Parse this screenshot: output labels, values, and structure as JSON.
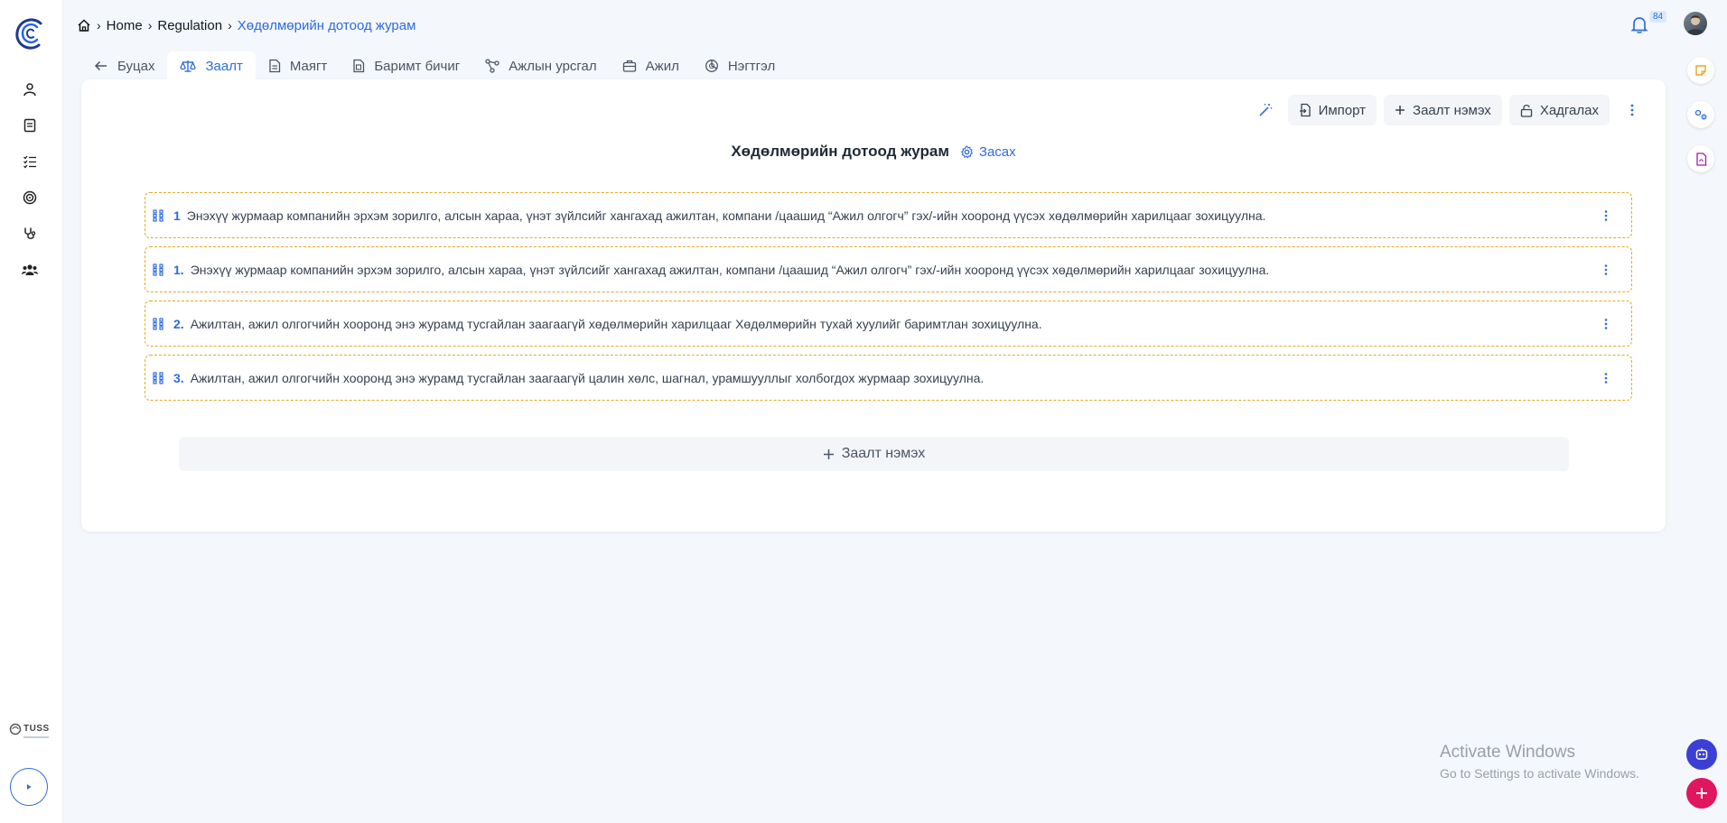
{
  "breadcrumb": {
    "items": [
      "Home",
      "Regulation"
    ],
    "current": "Хөдөлмөрийн дотоод журам"
  },
  "notifications": {
    "count": "84"
  },
  "tabs": [
    {
      "label": "Буцах",
      "icon": "arrow-left-icon"
    },
    {
      "label": "Заалт",
      "icon": "scale-icon"
    },
    {
      "label": "Маягт",
      "icon": "document-icon"
    },
    {
      "label": "Баримт бичиг",
      "icon": "file-text-icon"
    },
    {
      "label": "Ажлын урсгал",
      "icon": "workflow-icon"
    },
    {
      "label": "Ажил",
      "icon": "briefcase-icon"
    },
    {
      "label": "Нэгтгэл",
      "icon": "chart-pie-icon"
    }
  ],
  "toolbar": {
    "import_label": "Импорт",
    "add_clause_label": "Заалт нэмэх",
    "save_label": "Хадгалах"
  },
  "document": {
    "title": "Хөдөлмөрийн дотоод журам",
    "edit_label": "Засах"
  },
  "clauses": [
    {
      "number": "1",
      "text": "Энэхүү журмаар компанийн эрхэм зорилго, алсын хараа, үнэт зүйлсийг хангахад ажилтан, компани /цаашид “Ажил олгогч” гэх/-ийн хооронд үүсэх хөдөлмөрийн харилцааг зохицуулна."
    },
    {
      "number": "1.",
      "text": "Энэхүү журмаар компанийн эрхэм зорилго, алсын хараа, үнэт зүйлсийг хангахад ажилтан, компани /цаашид “Ажил олгогч” гэх/-ийн хооронд үүсэх хөдөлмөрийн харилцааг зохицуулна."
    },
    {
      "number": "2.",
      "text": "Ажилтан, ажил олгогчийн хооронд энэ журамд тусгайлан заагаагүй хөдөлмөрийн харилцааг Хөдөлмөрийн тухай хуулийг баримтлан зохицуулна."
    },
    {
      "number": "3.",
      "text": "Ажилтан, ажил олгогчийн хооронд энэ журамд тусгайлан заагаагүй цалин хөлс, шагнал, урамшууллыг холбогдох журмаар зохицуулна."
    }
  ],
  "add_clause_bottom_label": "Заалт нэмэх",
  "brand": {
    "name": "TUSS"
  },
  "watermark": {
    "line1": "Activate Windows",
    "line2": "Go to Settings to activate Windows."
  },
  "colors": {
    "accent": "#2d6cdf",
    "clause_border": "#e5a823",
    "fab_blue": "#3b3fd6",
    "fab_pink": "#e0175f"
  }
}
